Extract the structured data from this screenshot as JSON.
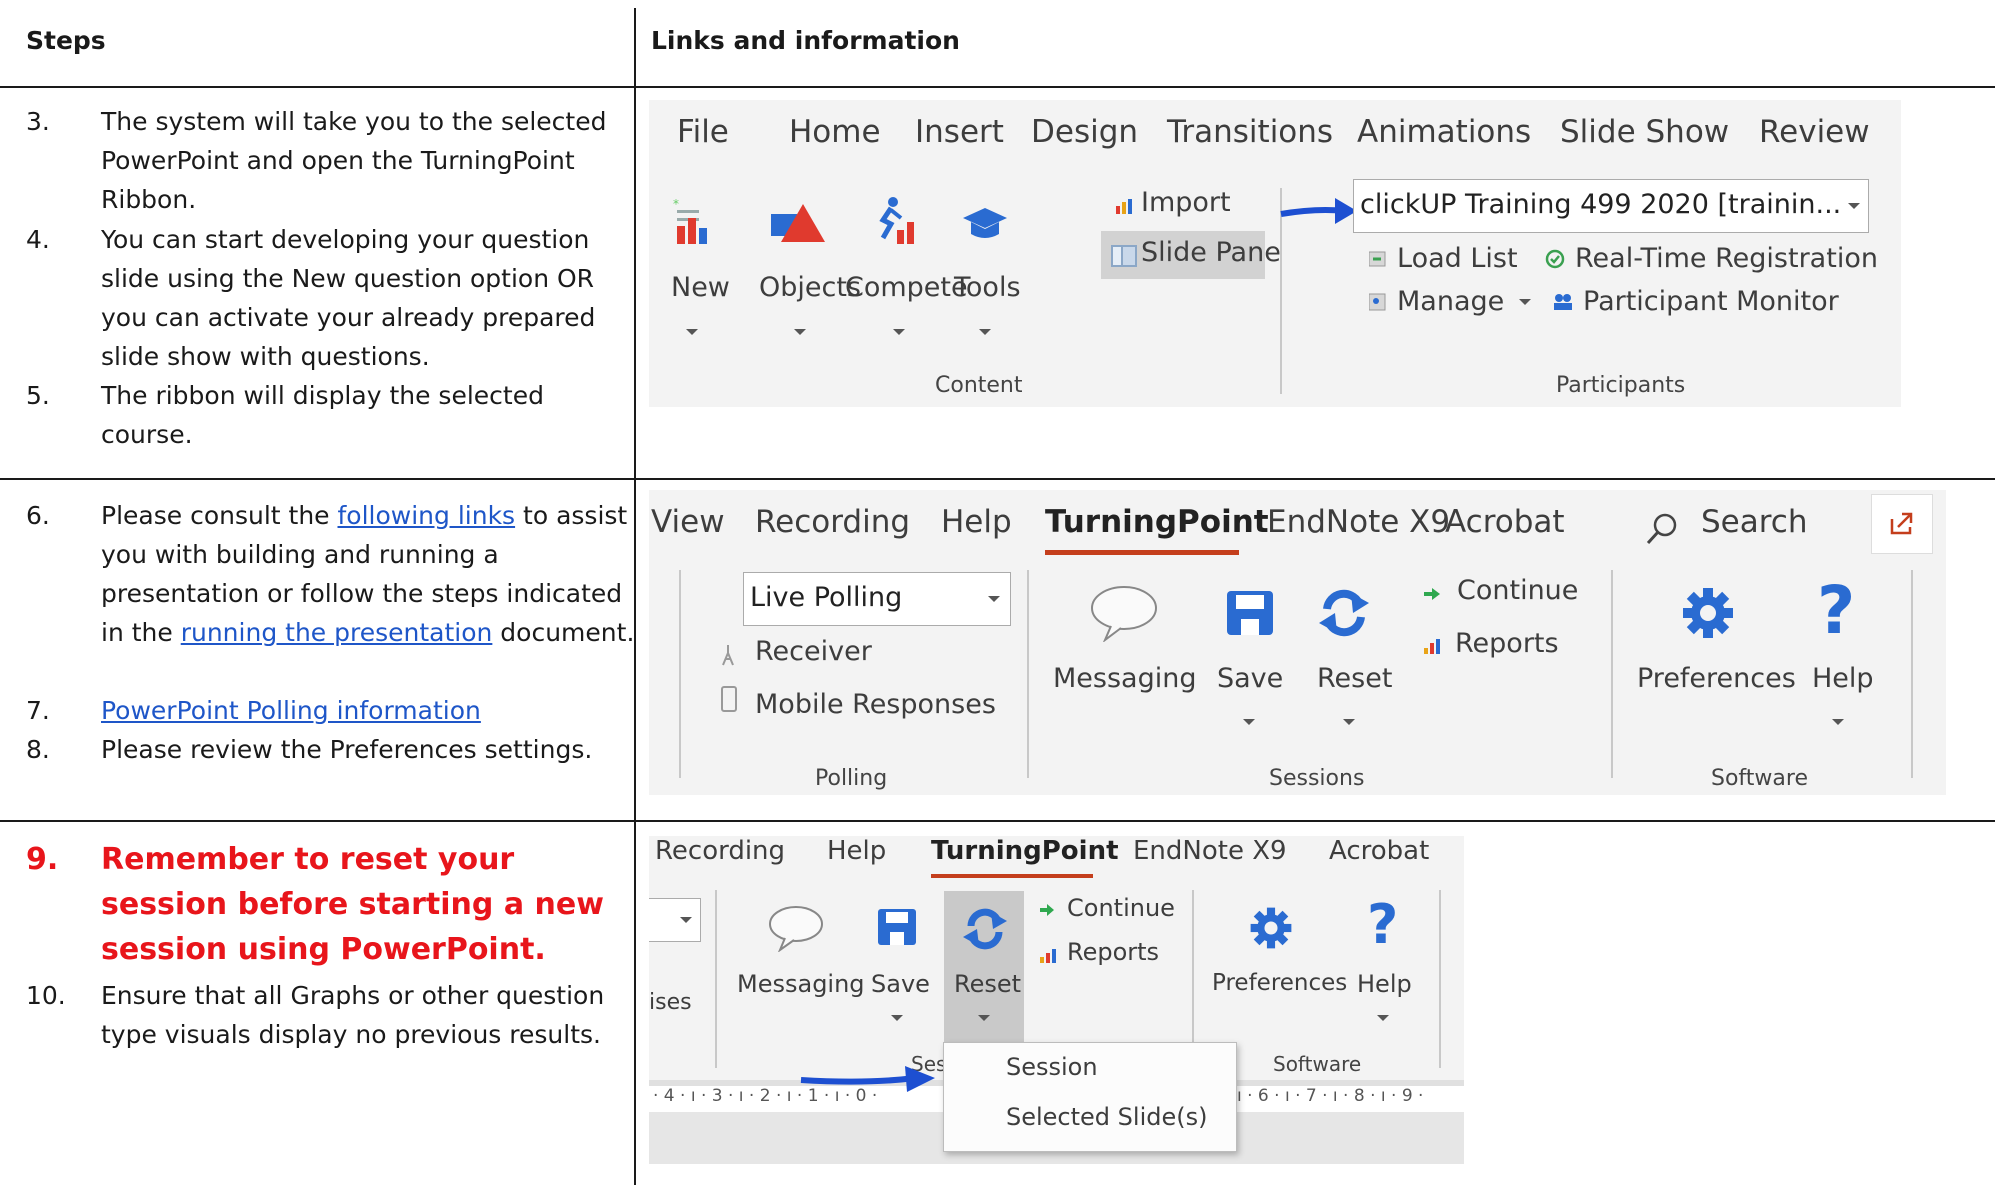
{
  "headers": {
    "steps": "Steps",
    "links": "Links and information"
  },
  "rows": [
    {
      "steps": [
        {
          "num": "3.",
          "text": "The system will take you to the selected PowerPoint and open the TurningPoint Ribbon."
        },
        {
          "num": "4.",
          "text": "You can start developing your question slide using the New question option OR you can activate your already prepared slide show with questions."
        },
        {
          "num": "5.",
          "text": "The ribbon will display the selected course."
        }
      ]
    },
    {
      "steps": [
        {
          "num": "6.",
          "pre": "Please consult the ",
          "link1": "following links",
          "mid": " to assist you with building and running a presentation or follow the steps indicated in the ",
          "link2": "running the presentation",
          "post": " document."
        },
        {
          "num": "7.",
          "link": "PowerPoint Polling information"
        },
        {
          "num": "8.",
          "text": "Please review the Preferences settings."
        }
      ]
    },
    {
      "steps": [
        {
          "num": "9.",
          "text": "Remember to reset your session before starting a new session using PowerPoint."
        },
        {
          "num": "10.",
          "text": "Ensure that all Graphs or other question type visuals display no previous results."
        }
      ]
    }
  ],
  "ribbon1": {
    "tabs": [
      "File",
      "Home",
      "Insert",
      "Design",
      "Transitions",
      "Animations",
      "Slide Show",
      "Review"
    ],
    "buttons": [
      "New",
      "Objects",
      "Compete",
      "Tools"
    ],
    "import": "Import",
    "slide_pane": "Slide Pane",
    "course": "clickUP Training 499 2020  [trainin...",
    "load_list": "Load List",
    "realtime": "Real-Time Registration",
    "manage": "Manage",
    "monitor": "Participant Monitor",
    "group_content": "Content",
    "group_participants": "Participants"
  },
  "ribbon2": {
    "tabs": [
      "View",
      "Recording",
      "Help",
      "TurningPoint",
      "EndNote X9",
      "Acrobat"
    ],
    "search": "Search",
    "polling_mode": "Live Polling",
    "receiver": "Receiver",
    "mobile": "Mobile Responses",
    "buttons": [
      "Messaging",
      "Save",
      "Reset"
    ],
    "continue": "Continue",
    "reports": "Reports",
    "software_buttons": [
      "Preferences",
      "Help"
    ],
    "group_polling": "Polling",
    "group_sessions": "Sessions",
    "group_software": "Software"
  },
  "ribbon3": {
    "tabs": [
      "Recording",
      "Help",
      "TurningPoint",
      "EndNote X9",
      "Acrobat"
    ],
    "buttons": [
      "Messaging",
      "Save",
      "Reset"
    ],
    "continue": "Continue",
    "reports": "Reports",
    "software_buttons": [
      "Preferences",
      "Help"
    ],
    "partial_left": "ises",
    "group_sessions_partial": "Ses",
    "group_software": "Software",
    "menu_items": [
      "Session",
      "Selected Slide(s)"
    ],
    "ruler": "· 4 · ı · 3 · ı · 2 · ı · 1 · ı · 0 ·",
    "ruler_right": "ı · 6 · ı · 7 · ı · 8 · ı · 9 ·"
  },
  "colors": {
    "accent_red": "#e8151b",
    "link_blue": "#1e56c8",
    "turningpoint_underline": "#c43e1c",
    "icon_blue": "#1e6fc8"
  }
}
